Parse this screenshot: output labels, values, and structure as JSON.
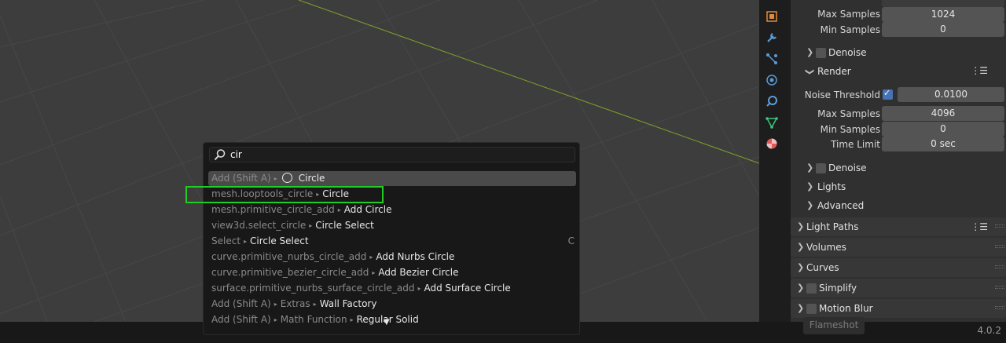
{
  "search": {
    "query": "cir"
  },
  "results": [
    {
      "path": "Add (Shift A)",
      "name": "Circle",
      "icon": "circle-icon",
      "shortcut": ""
    },
    {
      "path": "mesh.looptools_circle",
      "name": "Circle",
      "shortcut": ""
    },
    {
      "path": "mesh.primitive_circle_add",
      "name": "Add Circle",
      "shortcut": ""
    },
    {
      "path": "view3d.select_circle",
      "name": "Circle Select",
      "shortcut": ""
    },
    {
      "path": "Select",
      "name": "Circle Select",
      "shortcut": "C"
    },
    {
      "path": "curve.primitive_nurbs_circle_add",
      "name": "Add Nurbs Circle",
      "shortcut": ""
    },
    {
      "path": "curve.primitive_bezier_circle_add",
      "name": "Add Bezier Circle",
      "shortcut": ""
    },
    {
      "path": "surface.primitive_nurbs_surface_circle_add",
      "name": "Add Surface Circle",
      "shortcut": ""
    },
    {
      "path": "Add (Shift A)",
      "path2": "Extras",
      "name": "Wall Factory",
      "shortcut": ""
    },
    {
      "path": "Add (Shift A)",
      "path2": "Math Function",
      "name": "Regular Solid",
      "shortcut": ""
    }
  ],
  "properties": {
    "viewport_max_samples_label": "Max Samples",
    "viewport_max_samples": "1024",
    "viewport_min_samples_label": "Min Samples",
    "viewport_min_samples": "0",
    "denoise_label": "Denoise",
    "render_label": "Render",
    "noise_threshold_label": "Noise Threshold",
    "noise_threshold": "0.0100",
    "render_max_samples_label": "Max Samples",
    "render_max_samples": "4096",
    "render_min_samples_label": "Min Samples",
    "render_min_samples": "0",
    "time_limit_label": "Time Limit",
    "time_limit": "0 sec",
    "denoise2_label": "Denoise",
    "lights_label": "Lights",
    "advanced_label": "Advanced",
    "light_paths_label": "Light Paths",
    "volumes_label": "Volumes",
    "curves_label": "Curves",
    "simplify_label": "Simplify",
    "motion_blur_label": "Motion Blur"
  },
  "statusbar": {
    "version": "4.0.2",
    "flameshot": "Flameshot"
  },
  "colors": {
    "accent": "#4772b3",
    "highlight_box": "#22cc22",
    "viewport": "#3d3d3d"
  }
}
